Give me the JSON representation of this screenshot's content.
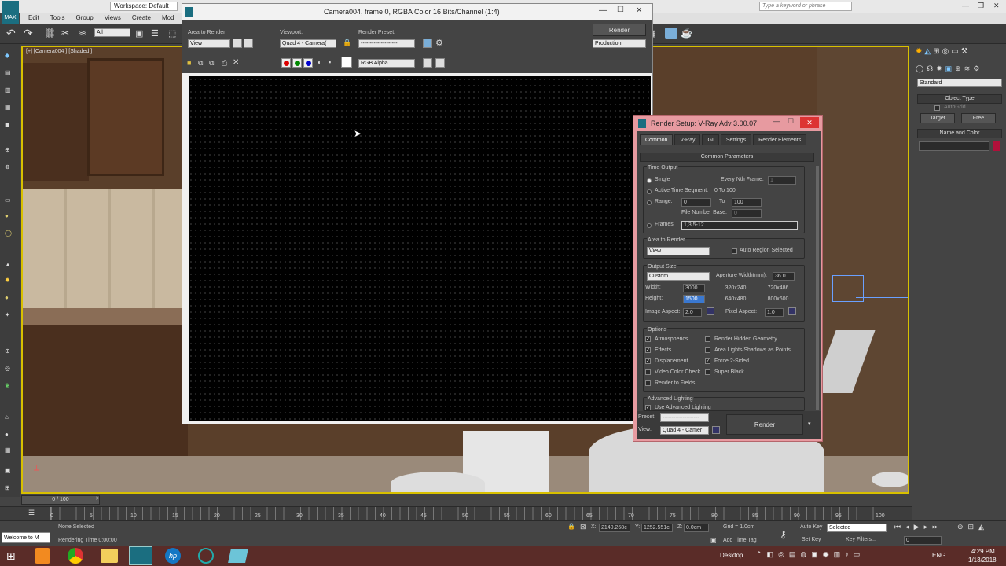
{
  "app": {
    "title_workspace": "Workspace: Default",
    "menu": [
      "Edit",
      "Tools",
      "Group",
      "Views",
      "Create",
      "Mod"
    ],
    "search_placeholder": "Type a keyword or phrase",
    "selection_filter": "All"
  },
  "viewport": {
    "label": "[+] [Camera004 ] [Shaded ]"
  },
  "frame_window": {
    "title": "Camera004, frame 0, RGBA Color 16 Bits/Channel (1:4)",
    "area_label": "Area to Render:",
    "area_value": "View",
    "viewport_label": "Viewport:",
    "viewport_value": "Quad 4 - Camera(",
    "preset_label": "Render Preset:",
    "preset_value": "--------------------",
    "render_btn": "Render",
    "render_mode": "Production",
    "channel": "RGB Alpha"
  },
  "render_setup": {
    "title": "Render Setup: V-Ray Adv 3.00.07",
    "tabs": [
      "Common",
      "V-Ray",
      "GI",
      "Settings",
      "Render Elements"
    ],
    "rollout": "Common Parameters",
    "time_output": "Time Output",
    "single": "Single",
    "every_nth": "Every Nth Frame:",
    "every_nth_val": "1",
    "active_segment": "Active Time Segment:",
    "active_range": "0 To 100",
    "range": "Range:",
    "range_from": "0",
    "range_to_label": "To",
    "range_to": "100",
    "file_number_base": "File Number Base:",
    "fnb_val": "0",
    "frames": "Frames",
    "frames_val": "1,3,5-12",
    "area_to_render": "Area to Render",
    "area_val": "View",
    "auto_region": "Auto Region Selected",
    "output_size": "Output Size",
    "size_preset": "Custom",
    "aperture": "Aperture Width(mm):",
    "aperture_val": "36.0",
    "width": "Width:",
    "width_val": "3000",
    "height": "Height:",
    "height_val": "1500",
    "p1": "320x240",
    "p2": "720x486",
    "p3": "640x480",
    "p4": "800x600",
    "image_aspect": "Image Aspect:",
    "image_aspect_val": "2.0",
    "pixel_aspect": "Pixel Aspect:",
    "pixel_aspect_val": "1.0",
    "options": "Options",
    "atmospherics": "Atmospherics",
    "render_hidden": "Render Hidden Geometry",
    "effects": "Effects",
    "area_lights": "Area Lights/Shadows as Points",
    "displacement": "Displacement",
    "force2": "Force 2-Sided",
    "video_color": "Video Color Check",
    "super_black": "Super Black",
    "render_fields": "Render to Fields",
    "advanced_lighting": "Advanced Lighting",
    "use_adv": "Use Advanced Lighting",
    "preset_label": "Preset:",
    "preset_val": "--------------------",
    "view_label": "View:",
    "view_val": "Quad 4 - Camer",
    "render_btn": "Render"
  },
  "command_panel": {
    "dropdown": "Standard",
    "object_type": "Object Type",
    "autogrid": "AutoGrid",
    "target": "Target",
    "free": "Free",
    "name_color": "Name and Color"
  },
  "timeline": {
    "slider": "0 / 100",
    "ticks": [
      "0",
      "5",
      "10",
      "15",
      "20",
      "25",
      "30",
      "35",
      "40",
      "45",
      "50",
      "55",
      "60",
      "65",
      "70",
      "75",
      "80",
      "85",
      "90",
      "95",
      "100"
    ]
  },
  "status": {
    "maxscript": "Welcome to M",
    "none_selected": "None Selected",
    "rendering_time": "Rendering Time 0:00:00",
    "x_label": "X:",
    "x": "2140.268c",
    "y_label": "Y:",
    "y": "1252.551c",
    "z_label": "Z:",
    "z": "0.0cm",
    "grid": "Grid = 1.0cm",
    "add_time_tag": "Add Time Tag",
    "auto_key": "Auto Key",
    "selected": "Selected",
    "set_key": "Set Key",
    "key_filters": "Key Filters...",
    "frame_val": "0"
  },
  "taskbar": {
    "desktop": "Desktop",
    "lang": "ENG",
    "time": "4:29 PM",
    "date": "1/13/2018"
  }
}
